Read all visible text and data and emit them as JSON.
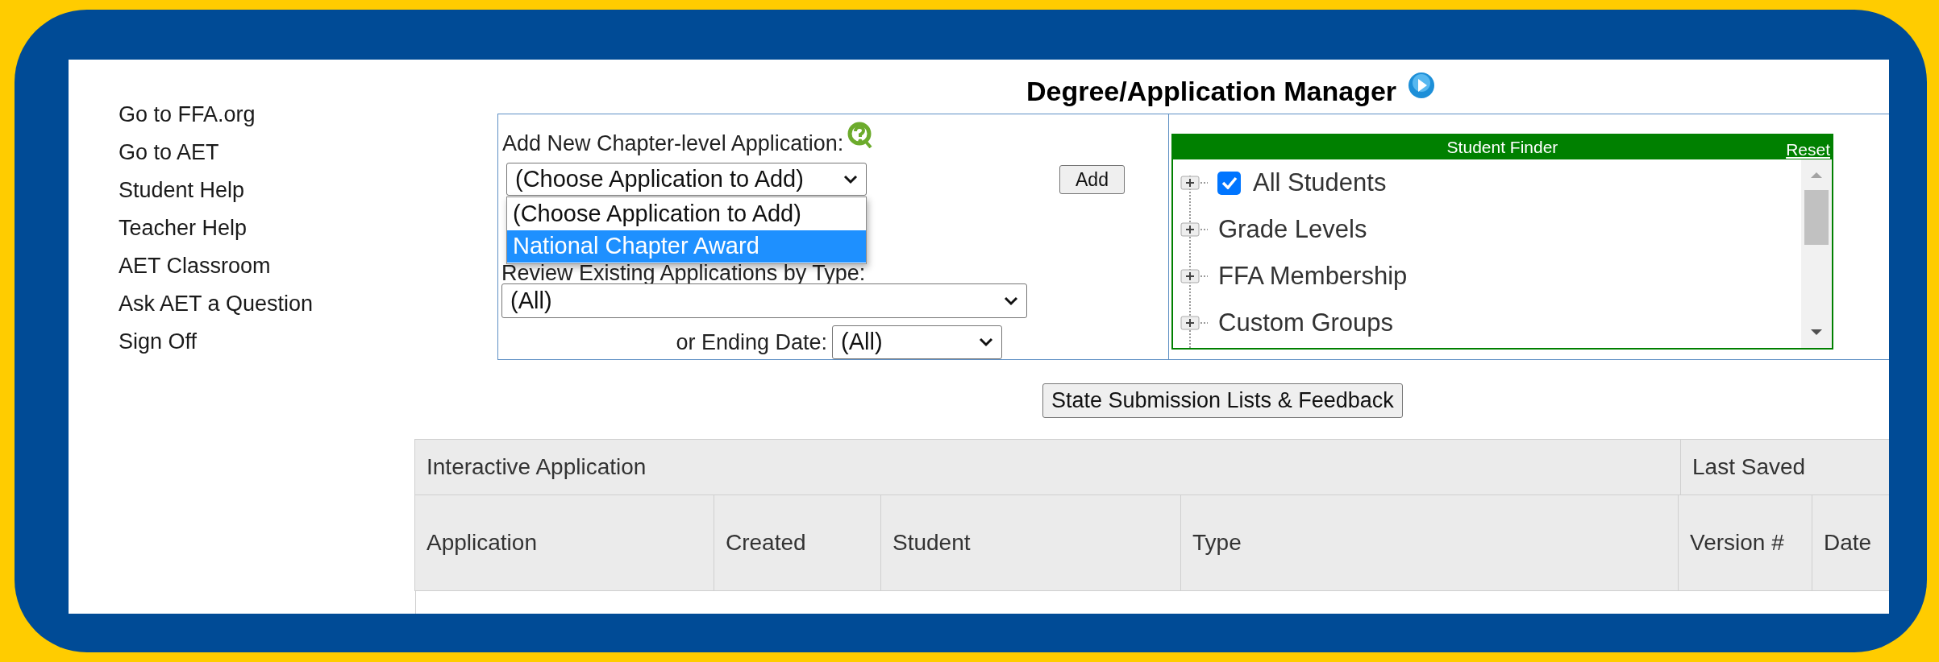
{
  "sidebar": {
    "links": [
      "Go to FFA.org",
      "Go to AET",
      "Student Help",
      "Teacher Help",
      "AET Classroom",
      "Ask AET a Question",
      "Sign Off"
    ]
  },
  "title": "Degree/Application Manager",
  "add_application": {
    "label": "Add New Chapter-level Application:",
    "select": {
      "value": "(Choose Application to Add)",
      "expanded": true,
      "options": [
        {
          "label": "(Choose Application to Add)",
          "highlighted": false
        },
        {
          "label": "National Chapter Award",
          "highlighted": true
        }
      ]
    },
    "button": "Add"
  },
  "review": {
    "label": "Review Existing Applications by Type:",
    "type_select": "(All)",
    "date_label": "or Ending Date:",
    "date_select": "(All)"
  },
  "student_finder": {
    "title": "Student Finder",
    "reset": "Reset",
    "items": [
      {
        "kind": "checkbox",
        "label": "All Students",
        "checked": true
      },
      {
        "kind": "group",
        "label": "Grade Levels"
      },
      {
        "kind": "group",
        "label": "FFA Membership"
      },
      {
        "kind": "group",
        "label": "Custom Groups"
      }
    ]
  },
  "feedback_button": "State Submission Lists & Feedback",
  "table": {
    "column_groups": [
      {
        "label": "Interactive Application",
        "columns": [
          "Application",
          "Created",
          "Student",
          "Type"
        ]
      },
      {
        "label": "Last Saved",
        "columns": [
          "Version #",
          "Date"
        ]
      }
    ]
  }
}
